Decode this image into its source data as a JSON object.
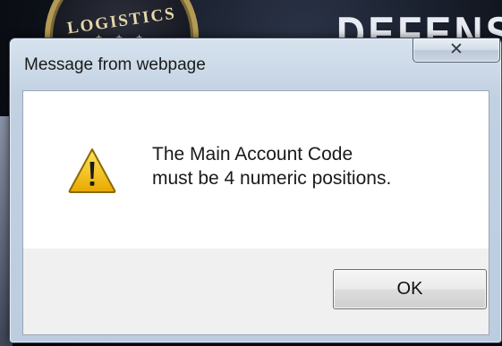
{
  "background": {
    "seal_text": "LOGISTICS",
    "seal_stars": "★ ★ ★",
    "banner_text": "DEFENS"
  },
  "dialog": {
    "title": "Message from webpage",
    "close_glyph": "✕",
    "icon": "warning-triangle-icon",
    "message_line_1": "The Main Account Code",
    "message_line_2": "must be 4 numeric positions.",
    "ok_label": "OK"
  },
  "colors": {
    "warning_yellow": "#f5c518",
    "warning_outline": "#8a6a00",
    "content_white": "#ffffff",
    "button_area": "#f0f0f0"
  }
}
